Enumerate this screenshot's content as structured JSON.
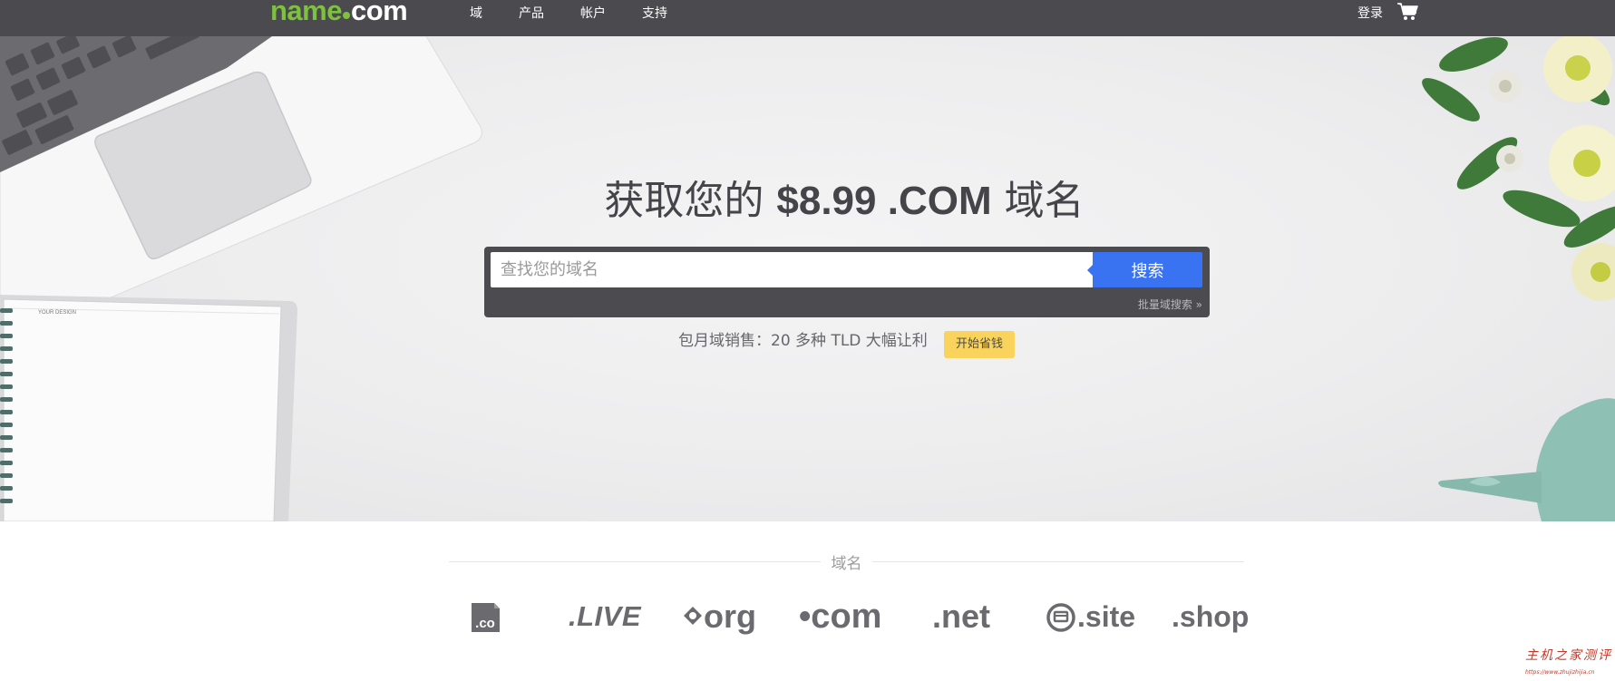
{
  "header": {
    "logo": {
      "name": "name",
      "tld": "com"
    },
    "nav": [
      {
        "label": "域"
      },
      {
        "label": "产品"
      },
      {
        "label": "帐户"
      },
      {
        "label": "支持"
      }
    ],
    "login_label": "登录",
    "cart_icon": "cart-icon"
  },
  "hero": {
    "headline_pre": "获取您的 ",
    "headline_price": "$8.99 .COM",
    "headline_post": " 域名",
    "search": {
      "placeholder": "查找您的域名",
      "button_label": "搜索",
      "bulk_link": "批量域搜索 »"
    },
    "promo_text": "包月域销售：20 多种 TLD 大幅让利",
    "promo_button": "开始省钱"
  },
  "domains": {
    "section_label": "域名",
    "tlds": [
      ".co",
      ".LIVE",
      "org",
      "•com",
      ".net",
      ".site",
      ".shop"
    ]
  },
  "colors": {
    "topbar": "#4a4a4f",
    "logo_green": "#7ec13f",
    "search_button": "#3a73f2",
    "promo_button": "#f9d35b",
    "tld_gray": "#6a6a6f"
  },
  "watermark": {
    "text": "主机之家测评",
    "url": "https://www.zhujizhijia.cn"
  }
}
